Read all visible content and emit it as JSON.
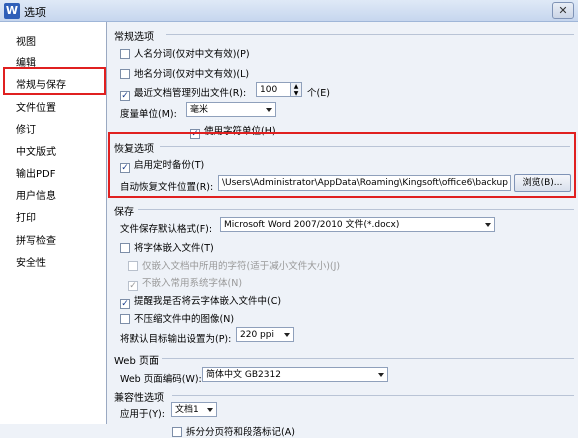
{
  "window": {
    "title": "选项",
    "app_icon": "W",
    "close": "✕"
  },
  "sidebar": {
    "items": [
      {
        "label": "视图"
      },
      {
        "label": "编辑"
      },
      {
        "label": "常规与保存"
      },
      {
        "label": "文件位置"
      },
      {
        "label": "修订"
      },
      {
        "label": "中文版式"
      },
      {
        "label": "输出PDF"
      },
      {
        "label": "用户信息"
      },
      {
        "label": "打印"
      },
      {
        "label": "拼写检查"
      },
      {
        "label": "安全性"
      }
    ],
    "selected": "常规与保存"
  },
  "general": {
    "title": "常规选项",
    "name_split": {
      "label": "人名分词(仅对中文有效)(P)",
      "checked": false
    },
    "place_split": {
      "label": "地名分词(仅对中文有效)(L)",
      "checked": false
    },
    "recent_files": {
      "label": "最近文档管理列出文件(R):",
      "checked": true,
      "value": "100",
      "unit": "个(E)"
    },
    "measure_label": "度量单位(M):",
    "measure_value": "毫米",
    "char_unit": {
      "label": "使用字符单位(H)",
      "checked": true
    }
  },
  "recovery": {
    "title": "恢复选项",
    "timed_backup": {
      "label": "启用定时备份(T)",
      "checked": true
    },
    "path_label": "自动恢复文件位置(R):",
    "path_value": "\\Users\\Administrator\\AppData\\Roaming\\Kingsoft\\office6\\backup",
    "browse": "浏览(B)..."
  },
  "save": {
    "title": "保存",
    "format_label": "文件保存默认格式(F):",
    "format_value": "Microsoft Word 2007/2010 文件(*.docx)",
    "embed_fonts": {
      "label": "将字体嵌入文件(T)",
      "checked": false
    },
    "embed_used_only": {
      "label": "仅嵌入文档中所用的字符(适于减小文件大小)(J)",
      "checked": false
    },
    "no_common_fonts": {
      "label": "不嵌入常用系统字体(N)",
      "checked": true
    },
    "remind_cloud": {
      "label": "提醒我是否将云字体嵌入文件中(C)",
      "checked": true
    },
    "no_compress": {
      "label": "不压缩文件中的图像(N)",
      "checked": false
    },
    "output_label": "将默认目标输出设置为(P):",
    "output_value": "220 ppi"
  },
  "web": {
    "title": "Web 页面",
    "encoding_label": "Web 页面编码(W):",
    "encoding_value": "简体中文 GB2312"
  },
  "compat": {
    "title": "兼容性选项",
    "apply_label": "应用于(Y):",
    "apply_value": "文档1",
    "split_pages": {
      "label": "拆分分页符和段落标记(A)",
      "checked": false
    }
  }
}
